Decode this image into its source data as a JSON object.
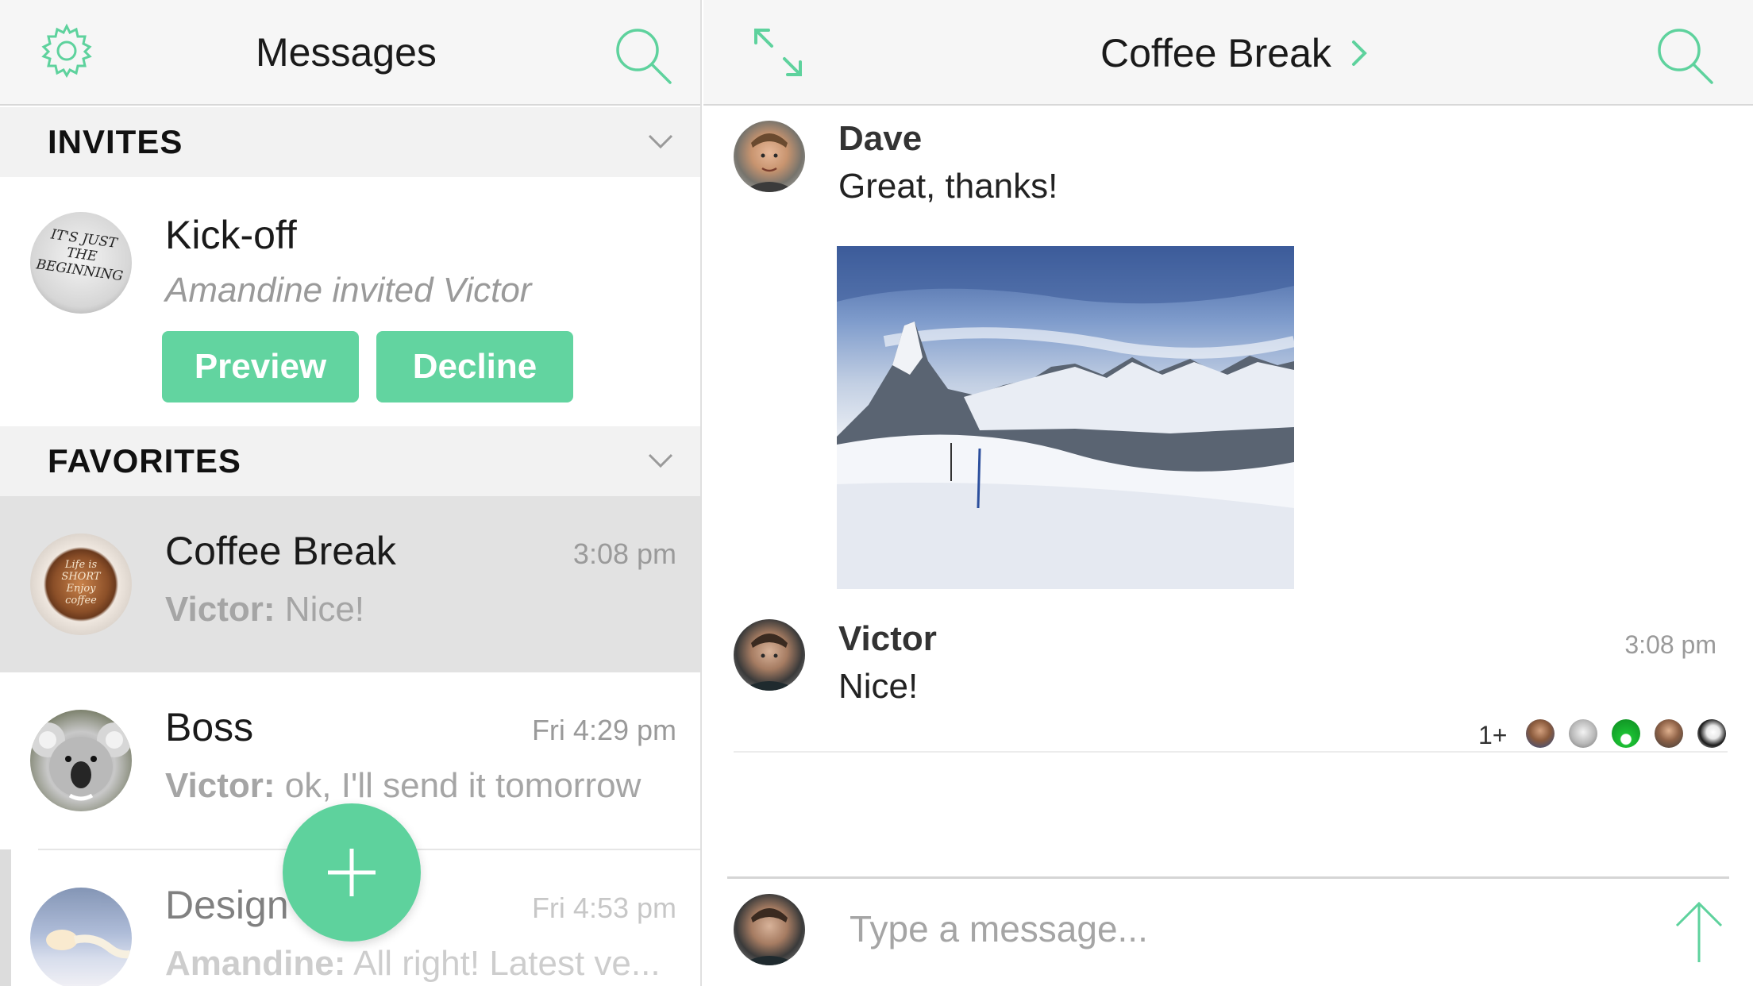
{
  "list_panel": {
    "title": "Messages",
    "settings_icon": "gear-icon",
    "search_icon": "search-icon"
  },
  "invites": {
    "header": "INVITES",
    "room_name": "Kick-off",
    "subtitle": "Amandine invited Victor",
    "avatar_text": "IT'S JUST THE BEGINNING",
    "preview_label": "Preview",
    "decline_label": "Decline"
  },
  "favorites": {
    "header": "FAVORITES",
    "rooms": [
      {
        "name": "Coffee Break",
        "time": "3:08 pm",
        "sender": "Victor:",
        "text": " Nice!",
        "avatar_text": "Life is SHORT Enjoy coffee"
      },
      {
        "name": "Boss",
        "time": "Fri 4:29 pm",
        "sender": "Victor:",
        "text": " ok, I'll send it tomorrow"
      },
      {
        "name": "Design",
        "time": "Fri 4:53 pm",
        "sender": "Amandine:",
        "text": " All right! Latest ve..."
      }
    ]
  },
  "room": {
    "title": "Coffee Break",
    "messages": [
      {
        "sender": "Dave",
        "text": "Great, thanks!"
      },
      {
        "sender": "Victor",
        "text": "Nice!",
        "time": "3:08 pm"
      }
    ],
    "read_receipts_count": "1+",
    "composer_placeholder": "Type a message..."
  },
  "colors": {
    "accent": "#5ed29d",
    "selected_row": "#e2e2e2",
    "section_bg": "#f2f2f2",
    "muted_text": "#a5a5a5"
  }
}
